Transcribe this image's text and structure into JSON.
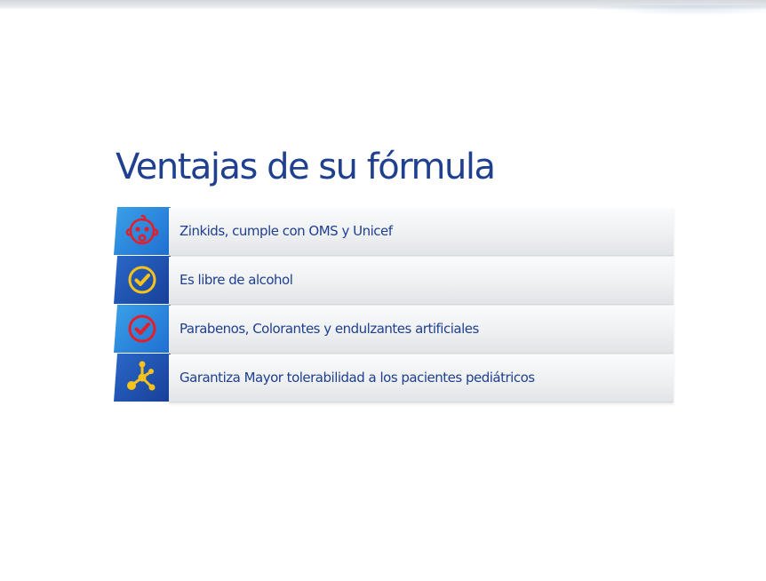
{
  "heading": "Ventajas de su fórmula",
  "items": [
    {
      "label": "Zinkids, cumple con OMS y Unicef",
      "icon": "baby-face-icon",
      "icon_color": "#e0202c"
    },
    {
      "label": "Es libre de alcohol",
      "icon": "check-circle-icon",
      "icon_color": "#f7c21a"
    },
    {
      "label": "Parabenos, Colorantes y endulzantes artificiales",
      "icon": "check-circle-icon",
      "icon_color": "#e0202c"
    },
    {
      "label": "Garantiza Mayor tolerabilidad a los pacientes pediátricos",
      "icon": "molecule-icon",
      "icon_color": "#f7c21a"
    }
  ],
  "colors": {
    "title": "#1f3f8f",
    "icon_box_light": "#3aa1e8",
    "icon_box_dark": "#173f98"
  }
}
